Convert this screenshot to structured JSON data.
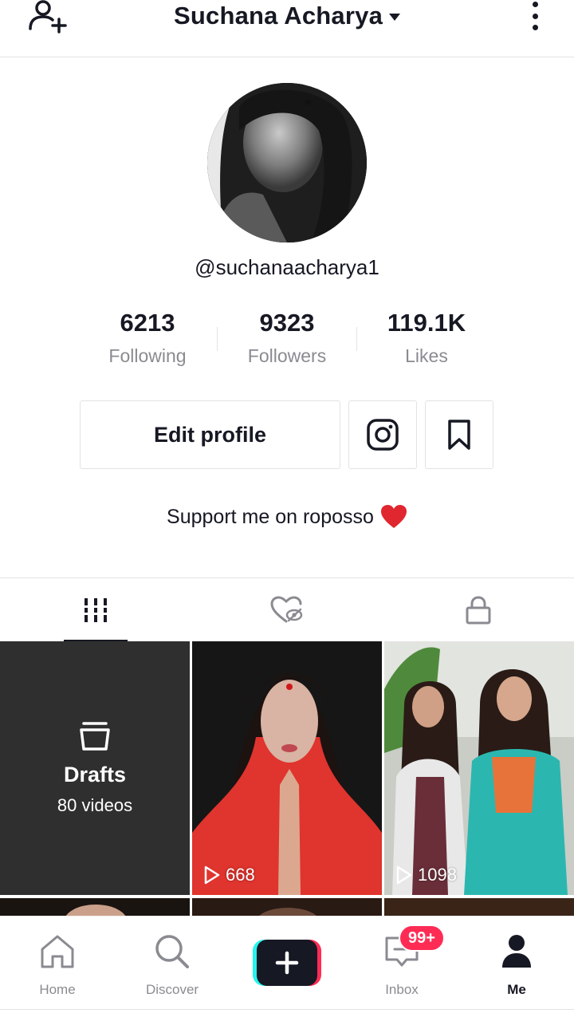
{
  "header": {
    "title": "Suchana Acharya",
    "add_user_icon": "add-user-icon",
    "more_icon": "more-vertical-icon"
  },
  "profile": {
    "handle": "@suchanaacharya1",
    "stats": [
      {
        "value": "6213",
        "label": "Following"
      },
      {
        "value": "9323",
        "label": "Followers"
      },
      {
        "value": "119.1K",
        "label": "Likes"
      }
    ],
    "edit_profile_label": "Edit profile",
    "bio": "Support me on roposso"
  },
  "tabs": [
    {
      "icon": "grid-icon",
      "active": true
    },
    {
      "icon": "liked-hidden-icon",
      "active": false
    },
    {
      "icon": "lock-icon",
      "active": false
    }
  ],
  "grid": {
    "drafts_label": "Drafts",
    "drafts_count": "80 videos",
    "videos": [
      {
        "views": "668"
      },
      {
        "views": "1098"
      }
    ]
  },
  "bottom_nav": {
    "items": [
      {
        "label": "Home",
        "icon": "home-icon"
      },
      {
        "label": "Discover",
        "icon": "search-icon"
      },
      {
        "label": "",
        "icon": "plus-icon"
      },
      {
        "label": "Inbox",
        "icon": "inbox-icon"
      },
      {
        "label": "Me",
        "icon": "person-icon"
      }
    ],
    "inbox_badge": "99+"
  },
  "colors": {
    "accent": "#fe2c55",
    "cyan": "#25f4ee",
    "text": "#161823",
    "muted": "#8a8b91"
  }
}
